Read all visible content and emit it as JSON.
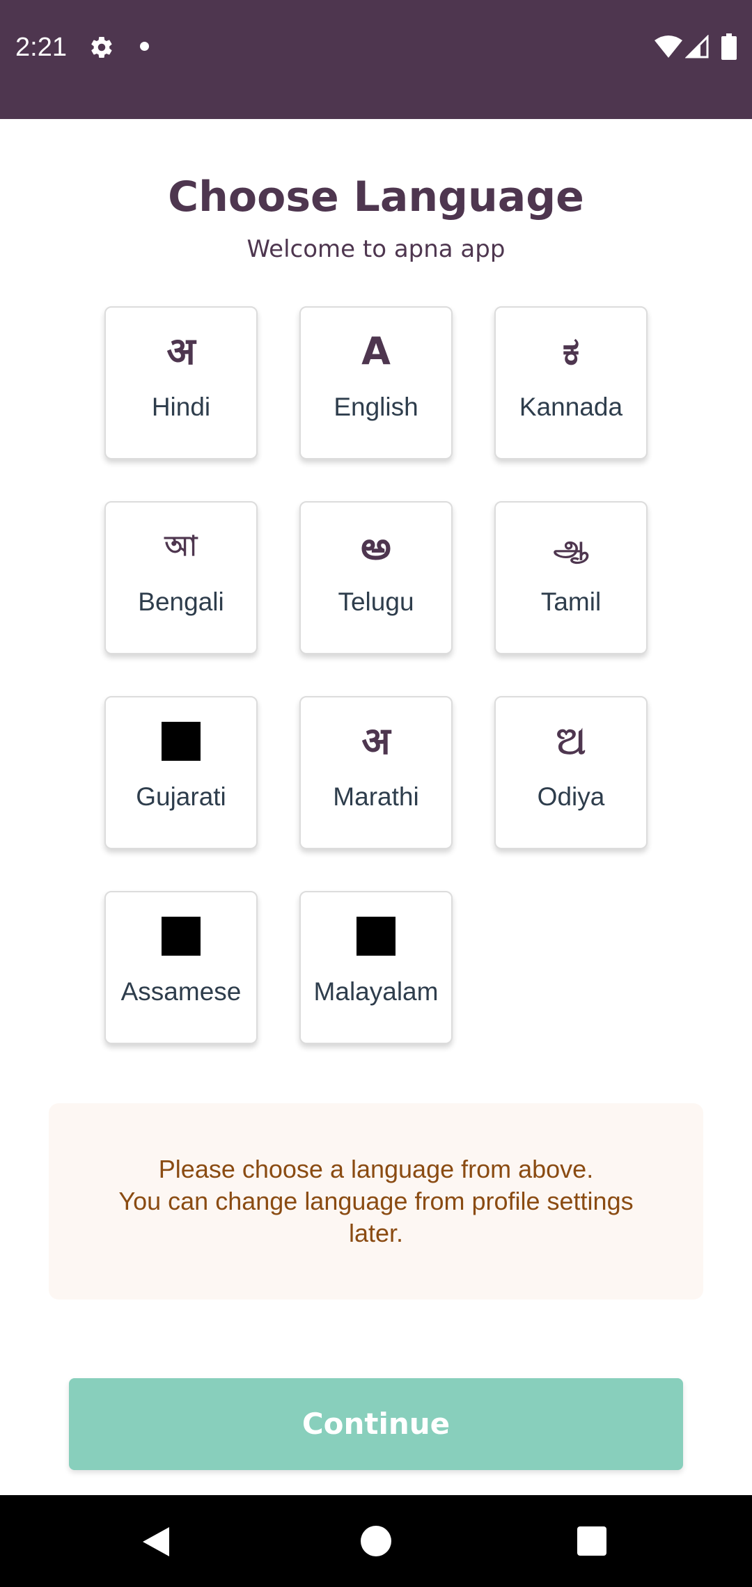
{
  "status_bar": {
    "time": "2:21",
    "icons": [
      "gear-icon",
      "notification-dot-icon",
      "wifi-icon",
      "cell-signal-icon",
      "battery-icon"
    ],
    "background": "#4e364f"
  },
  "header": {
    "title": "Choose Language",
    "subtitle": "Welcome to apna app"
  },
  "languages": [
    {
      "glyph": "अ",
      "label": "Hindi"
    },
    {
      "glyph": "A",
      "label": "English"
    },
    {
      "glyph": "ಕ",
      "label": "Kannada"
    },
    {
      "glyph": "আ",
      "label": "Bengali"
    },
    {
      "glyph": "అ",
      "label": "Telugu"
    },
    {
      "glyph": "ஆ",
      "label": "Tamil"
    },
    {
      "glyph": "",
      "label": "Gujarati"
    },
    {
      "glyph": "अ",
      "label": "Marathi"
    },
    {
      "glyph": "ଅ",
      "label": "Odiya"
    },
    {
      "glyph": "",
      "label": "Assamese"
    },
    {
      "glyph": "",
      "label": "Malayalam"
    }
  ],
  "info": {
    "text": "Please choose a language from above.\nYou can change language from profile settings later."
  },
  "continue_button": {
    "label": "Continue",
    "color": "#88cfbc",
    "enabled": false
  },
  "nav_bar": {
    "icons": [
      "back-icon",
      "home-icon",
      "recents-icon"
    ]
  },
  "colors": {
    "primary": "#4e364f",
    "info_text": "#8a4b12",
    "info_background": "#fdf7f3",
    "label_text": "#2e3d4c"
  }
}
